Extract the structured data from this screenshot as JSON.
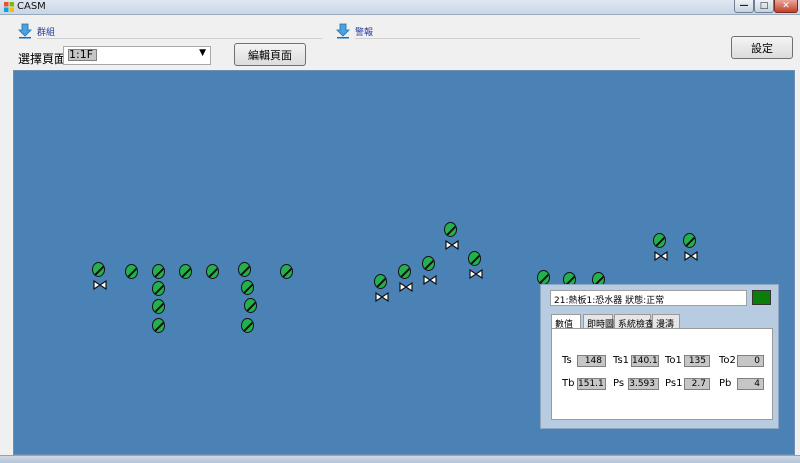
{
  "window": {
    "title": "CASM",
    "min_label": "—",
    "max_label": "□",
    "close_label": "✕"
  },
  "groups": {
    "group_label": "群組",
    "alarm_label": "警報"
  },
  "toolbar": {
    "page_label": "選擇頁面",
    "page_select_value": "1:1F",
    "edit_button": "編輯頁面",
    "settings_button": "設定"
  },
  "detail": {
    "title": "21:熱板1:恐水器 狀態:正常",
    "status_color": "#0a7d0a",
    "tabs": [
      "數值",
      "即時圖",
      "系統檢查",
      "漫濤"
    ],
    "active_tab": 0,
    "readings": [
      {
        "label": "Ts",
        "value": "148"
      },
      {
        "label": "Ts1",
        "value": "140.1"
      },
      {
        "label": "To1",
        "value": "135"
      },
      {
        "label": "To2",
        "value": "0"
      },
      {
        "label": "Tb",
        "value": "151.1"
      },
      {
        "label": "Ps",
        "value": "3.593"
      },
      {
        "label": "Ps1",
        "value": "2.7"
      },
      {
        "label": "Pb",
        "value": "4"
      }
    ]
  },
  "colors": {
    "canvas_bg": "#4a82b6",
    "device_green": "#22b14c",
    "status_normal": "#0a7d0a"
  },
  "icons": {
    "group": "download-arrow-icon",
    "alarm": "download-arrow-icon",
    "device": "device-ball-icon",
    "valve": "valve-icon"
  }
}
